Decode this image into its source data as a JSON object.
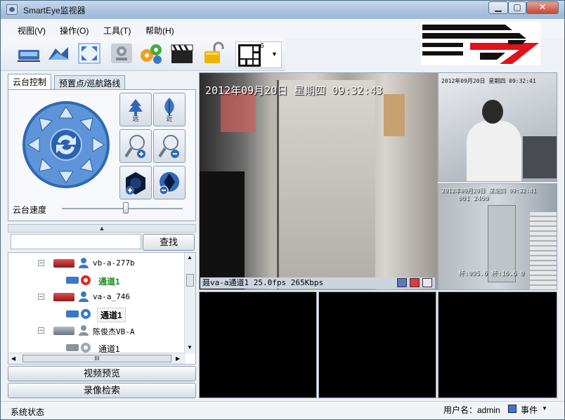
{
  "window": {
    "title": "SmartEye监视器",
    "min": "▁",
    "max": "▢",
    "close": "✕"
  },
  "menu": [
    "视图(V)",
    "操作(O)",
    "工具(T)",
    "帮助(H)"
  ],
  "toolbar": {
    "layout_count": "6"
  },
  "tabs": {
    "ptz": "云台控制",
    "preset": "预置点/巡航路线"
  },
  "ptz": {
    "far": "远",
    "near": "近",
    "speed_label": "云台速度",
    "speed_value": 0.53
  },
  "search": {
    "button": "查找",
    "value": ""
  },
  "tree": [
    {
      "device": "vb-a-277b",
      "channel": "通道1",
      "channel_color": "#1a8a1a"
    },
    {
      "device": "va-a_746",
      "channel": "通道1",
      "channel_color": "#000000"
    },
    {
      "device": "陈俊杰VB-A",
      "channel": "通道1",
      "channel_color": "#000000"
    }
  ],
  "scroll": {
    "h_thumb": "III"
  },
  "buttons": {
    "preview": "视频预览",
    "record": "录像检索"
  },
  "video": {
    "main_osd": "2012年09月20日 星期四 09:32:43",
    "main_status": "聂va-a通道1 25.0fps 265Kbps",
    "top_right_osd": "2012年09月20日 星期四 09:32:41",
    "mid_right_osd": "2012年09月20日 星期四 09:32:41",
    "mid_right_id": "001 2400",
    "mid_right_bottom": "杯:095.6 杯:16.6 0"
  },
  "status": {
    "left": "系统状态",
    "user": "用户名：admin",
    "event": "事件"
  },
  "colors": {
    "accent": "#3a78c8",
    "title": "#a9c3de"
  }
}
